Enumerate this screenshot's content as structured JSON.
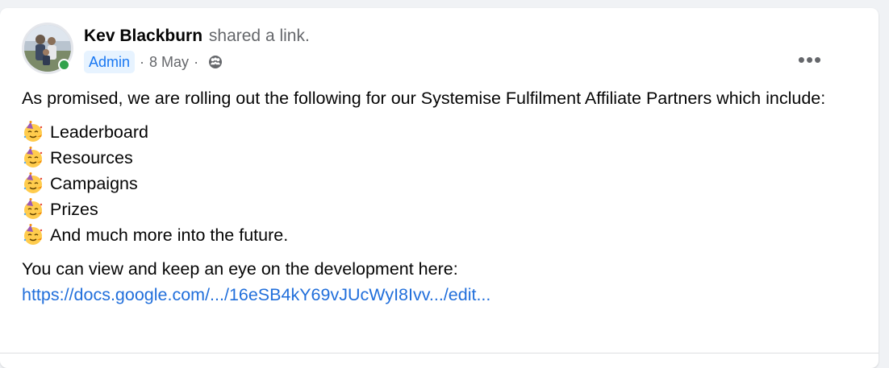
{
  "post": {
    "author": {
      "name": "Kev Blackburn",
      "action_text": "shared a link.",
      "badge": "Admin",
      "date": "8 May",
      "separator": "·",
      "online": true,
      "privacy_icon": "group-audience-icon"
    },
    "more_options_label": "•••",
    "more_options_icon": "more-options-icon",
    "body": {
      "intro": "As promised, we are rolling out the following for our Systemise Fulfilment Affiliate Partners which include:",
      "list_emoji": "partying-face-emoji",
      "items": [
        "Leaderboard",
        "Resources",
        "Campaigns",
        "Prizes",
        "And much more into the future."
      ],
      "closing": "You can view and keep an eye on the development here:",
      "link_text": "https://docs.google.com/.../16eSB4kY69vJUcWyI8Ivv.../edit..."
    }
  },
  "colors": {
    "admin_badge_bg": "#e7f3ff",
    "admin_badge_text": "#1877f2",
    "link": "#216fdb",
    "online": "#31a24c",
    "secondary_text": "#65676b"
  }
}
